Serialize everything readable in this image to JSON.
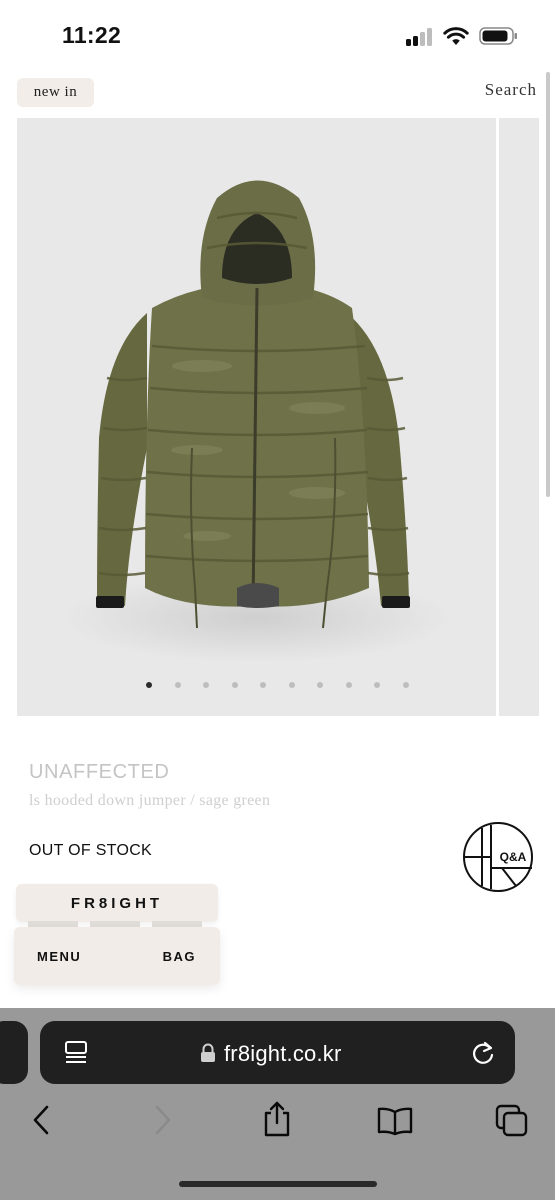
{
  "status_bar": {
    "time": "11:22"
  },
  "header": {
    "new_in_label": "new in",
    "search_label": "Search"
  },
  "gallery": {
    "slide_count": 10,
    "active_slide": 1
  },
  "product": {
    "brand": "UNAFFECTED",
    "name": "ls hooded down jumper / sage green",
    "stock_status": "OUT OF STOCK",
    "qa_logo_text": "Q&A"
  },
  "floating_nav": {
    "brand_label": "FR8IGHT",
    "menu_label": "MENU",
    "bag_label": "BAG"
  },
  "browser": {
    "url": "fr8ight.co.kr"
  },
  "colors": {
    "jacket": "#6b6d48",
    "image_bg": "#e8e8e8",
    "nav_card": "#f1ece7",
    "browser_chrome": "#999999",
    "address_bar": "#202020"
  }
}
